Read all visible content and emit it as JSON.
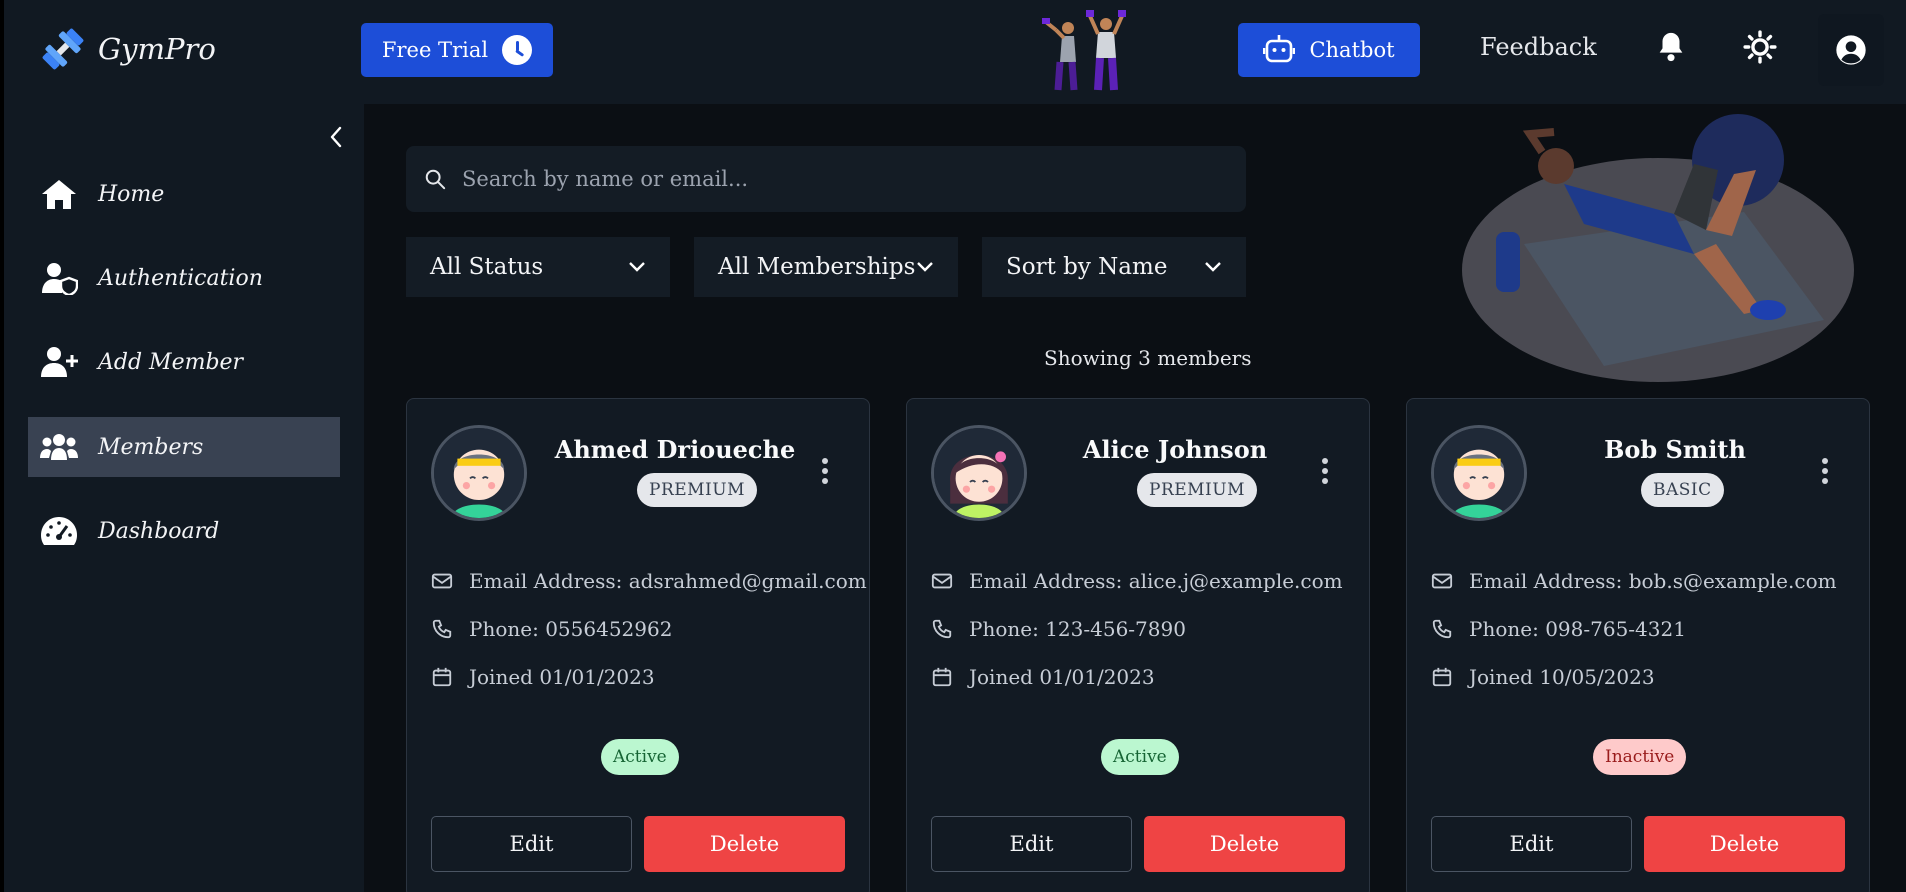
{
  "header": {
    "brand": "GymPro",
    "free_trial_label": "Free Trial",
    "chatbot_label": "Chatbot",
    "feedback_label": "Feedback"
  },
  "sidebar": {
    "items": [
      {
        "label": "Home",
        "icon": "home-icon"
      },
      {
        "label": "Authentication",
        "icon": "user-shield-icon"
      },
      {
        "label": "Add Member",
        "icon": "user-plus-icon"
      },
      {
        "label": "Members",
        "icon": "users-icon",
        "active": true
      },
      {
        "label": "Dashboard",
        "icon": "gauge-icon"
      }
    ]
  },
  "search": {
    "placeholder": "Search by name or email..."
  },
  "filters": {
    "status": "All Status",
    "membership": "All Memberships",
    "sort": "Sort by Name"
  },
  "showing_text": "Showing 3 members",
  "members": [
    {
      "name": "Ahmed Drioueche",
      "plan": "PREMIUM",
      "email": "Email Address: adsrahmed@gmail.com",
      "phone": "Phone: 0556452962",
      "joined": "Joined 01/01/2023",
      "status": "Active",
      "edit_label": "Edit",
      "delete_label": "Delete"
    },
    {
      "name": "Alice Johnson",
      "plan": "PREMIUM",
      "email": "Email Address: alice.j@example.com",
      "phone": "Phone: 123-456-7890",
      "joined": "Joined 01/01/2023",
      "status": "Active",
      "edit_label": "Edit",
      "delete_label": "Delete"
    },
    {
      "name": "Bob Smith",
      "plan": "BASIC",
      "email": "Email Address: bob.s@example.com",
      "phone": "Phone: 098-765-4321",
      "joined": "Joined 10/05/2023",
      "status": "Inactive",
      "edit_label": "Edit",
      "delete_label": "Delete"
    }
  ],
  "colors": {
    "accent": "#1d4ed8",
    "danger": "#ef4444",
    "active_badge": "#bbf7d0",
    "inactive_badge": "#fecaca"
  }
}
